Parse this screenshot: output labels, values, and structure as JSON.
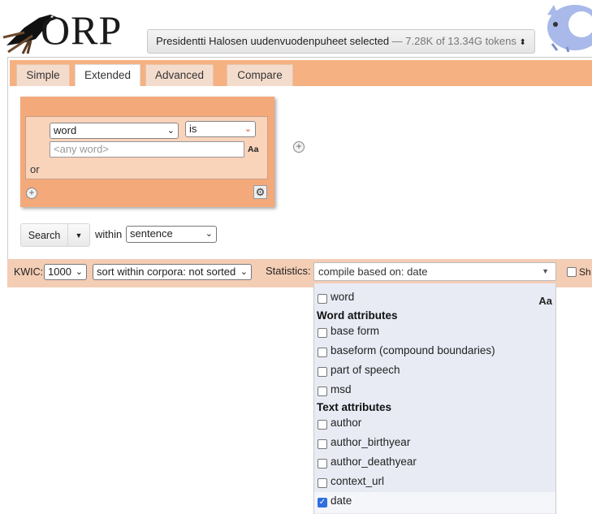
{
  "logo": {
    "text": "ORP"
  },
  "corpus": {
    "name": "Presidentti Halosen uudenvuodenpuheet selected",
    "detail": " — 7.28K of 13.34G tokens",
    "caret": "⬍"
  },
  "tabs": [
    "Simple",
    "Extended",
    "Advanced",
    "Compare"
  ],
  "query": {
    "attribute": "word",
    "operator": "is",
    "value_placeholder": "<any word>",
    "case_label": "Aa",
    "or_label": "or"
  },
  "search": {
    "button_label": "Search",
    "within_label": "within",
    "within_value": "sentence"
  },
  "options": {
    "kwic_label": "KWIC:",
    "kwic_value": "1000",
    "sort_value": "sort within corpora: not sorted",
    "stats_label": "Statistics:",
    "stats_value": "compile based on: date",
    "show_label": "Sh"
  },
  "dropdown": {
    "first_item": "word",
    "case_label": "Aa",
    "group_word": "Word attributes",
    "word_attrs": [
      "base form",
      "baseform (compound boundaries)",
      "part of speech",
      "msd"
    ],
    "group_text": "Text attributes",
    "text_attrs": [
      "author",
      "author_birthyear",
      "author_deathyear",
      "context_url",
      "date"
    ],
    "checked": "date"
  },
  "colors": {
    "accent": "#f4a97b",
    "tabbar": "#f6b183",
    "bar": "#f4cdb5",
    "checkbox": "#2f6fe0"
  }
}
